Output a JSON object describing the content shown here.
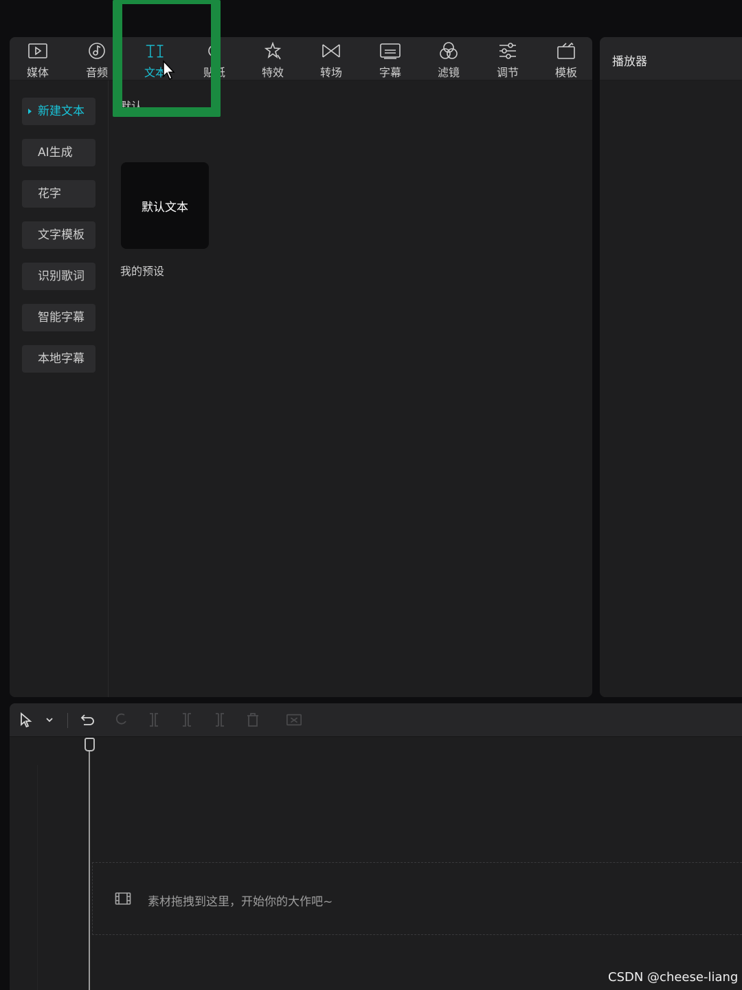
{
  "toolbar": {
    "tabs": [
      {
        "label": "媒体",
        "icon": "media-play-icon"
      },
      {
        "label": "音频",
        "icon": "audio-note-icon"
      },
      {
        "label": "文本",
        "icon": "text-ti-icon",
        "active": true
      },
      {
        "label": "贴纸",
        "icon": "sticker-icon"
      },
      {
        "label": "特效",
        "icon": "effects-star-icon"
      },
      {
        "label": "转场",
        "icon": "transition-bowtie-icon"
      },
      {
        "label": "字幕",
        "icon": "subtitle-icon"
      },
      {
        "label": "滤镜",
        "icon": "filter-circles-icon"
      },
      {
        "label": "调节",
        "icon": "adjust-sliders-icon"
      },
      {
        "label": "模板",
        "icon": "template-icon"
      }
    ]
  },
  "subnav": {
    "items": [
      {
        "label": "新建文本",
        "active": true
      },
      {
        "label": "AI生成"
      },
      {
        "label": "花字"
      },
      {
        "label": "文字模板"
      },
      {
        "label": "识别歌词"
      },
      {
        "label": "智能字幕"
      },
      {
        "label": "本地字幕"
      }
    ]
  },
  "content": {
    "default_section_label": "默认",
    "default_card_text": "默认文本",
    "my_presets_label": "我的预设"
  },
  "player": {
    "title": "播放器"
  },
  "timeline": {
    "drop_hint": "素材拖拽到这里，开始你的大作吧~"
  },
  "watermark": "CSDN @cheese-liang",
  "colors": {
    "accent": "#19c3d8",
    "highlight_box": "#1a8a40",
    "panel_bg": "#1e1e1f",
    "toolbar_bg": "#262628"
  }
}
